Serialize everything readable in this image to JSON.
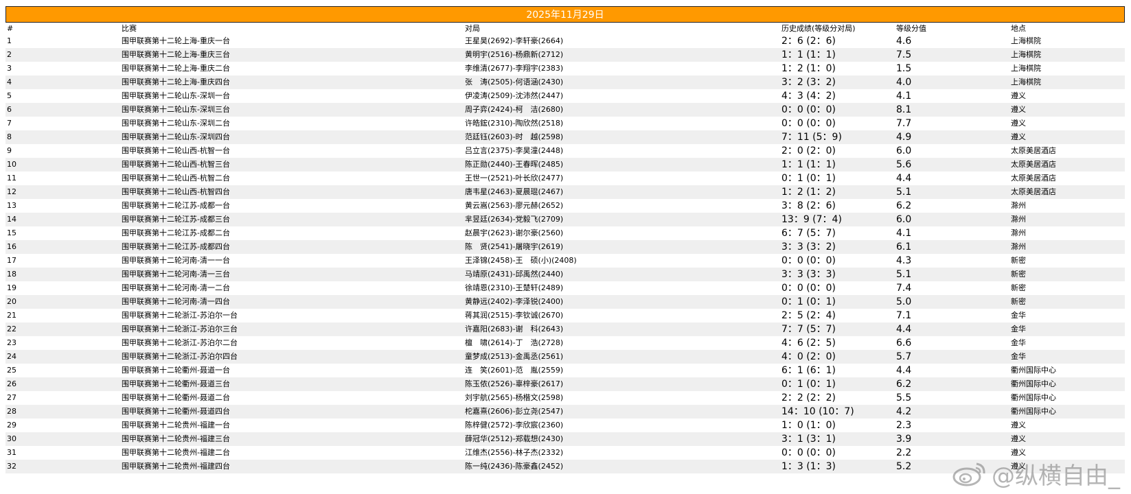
{
  "banner": {
    "date": "2025年11月29日"
  },
  "headers": {
    "num": "#",
    "match": "比赛",
    "game": "对局",
    "history": "历史成绩(等级分对局)",
    "diff": "等级分值",
    "location": "地点"
  },
  "rows": [
    {
      "num": "1",
      "match": "围甲联赛第十二轮上海-重庆一台",
      "game": "王星昊(2692)-李轩豪(2664)",
      "history": "2：6 (2：6)",
      "diff": "4.6",
      "location": "上海棋院"
    },
    {
      "num": "2",
      "match": "围甲联赛第十二轮上海-重庆三台",
      "game": "黄明宇(2516)-杨鼎新(2712)",
      "history": "1：1 (1：1)",
      "diff": "7.5",
      "location": "上海棋院"
    },
    {
      "num": "3",
      "match": "围甲联赛第十二轮上海-重庆二台",
      "game": "李维清(2677)-李翔宇(2383)",
      "history": "1：2 (1：0)",
      "diff": "1.5",
      "location": "上海棋院"
    },
    {
      "num": "4",
      "match": "围甲联赛第十二轮上海-重庆四台",
      "game": "张　涛(2505)-何语涵(2430)",
      "history": "3：2 (3：2)",
      "diff": "4.0",
      "location": "上海棋院"
    },
    {
      "num": "5",
      "match": "围甲联赛第十二轮山东-深圳一台",
      "game": "伊凌涛(2509)-沈沛然(2447)",
      "history": "4：3 (4：2)",
      "diff": "4.1",
      "location": "遵义"
    },
    {
      "num": "6",
      "match": "围甲联赛第十二轮山东-深圳三台",
      "game": "周子弈(2424)-柯　洁(2680)",
      "history": "0：0 (0：0)",
      "diff": "8.1",
      "location": "遵义"
    },
    {
      "num": "7",
      "match": "围甲联赛第十二轮山东-深圳二台",
      "game": "许皓鋐(2310)-陶欣然(2518)",
      "history": "0：0 (0：0)",
      "diff": "7.7",
      "location": "遵义"
    },
    {
      "num": "8",
      "match": "围甲联赛第十二轮山东-深圳四台",
      "game": "范廷钰(2603)-时　越(2598)",
      "history": "7：11 (5：9)",
      "diff": "4.9",
      "location": "遵义"
    },
    {
      "num": "9",
      "match": "围甲联赛第十二轮山西-杭智一台",
      "game": "吕立言(2375)-李昊潼(2448)",
      "history": "2：0 (2：0)",
      "diff": "6.0",
      "location": "太原美居酒店"
    },
    {
      "num": "10",
      "match": "围甲联赛第十二轮山西-杭智三台",
      "game": "陈正勋(2440)-王春晖(2485)",
      "history": "1：1 (1：1)",
      "diff": "5.6",
      "location": "太原美居酒店"
    },
    {
      "num": "11",
      "match": "围甲联赛第十二轮山西-杭智二台",
      "game": "王世一(2521)-叶长欣(2477)",
      "history": "0：1 (0：1)",
      "diff": "4.4",
      "location": "太原美居酒店"
    },
    {
      "num": "12",
      "match": "围甲联赛第十二轮山西-杭智四台",
      "game": "唐韦星(2463)-夏晨琨(2467)",
      "history": "1：2 (1：2)",
      "diff": "5.1",
      "location": "太原美居酒店"
    },
    {
      "num": "13",
      "match": "围甲联赛第十二轮江苏-成都一台",
      "game": "黄云嵩(2563)-廖元赫(2652)",
      "history": "3：8 (2：6)",
      "diff": "6.2",
      "location": "滁州"
    },
    {
      "num": "14",
      "match": "围甲联赛第十二轮江苏-成都三台",
      "game": "芈昱廷(2634)-党毅飞(2709)",
      "history": "13：9 (7：4)",
      "diff": "6.0",
      "location": "滁州"
    },
    {
      "num": "15",
      "match": "围甲联赛第十二轮江苏-成都二台",
      "game": "赵晨宇(2623)-谢尔豪(2560)",
      "history": "6：7 (5：7)",
      "diff": "4.1",
      "location": "滁州"
    },
    {
      "num": "16",
      "match": "围甲联赛第十二轮江苏-成都四台",
      "game": "陈　贤(2541)-屠晓宇(2619)",
      "history": "3：3 (3：2)",
      "diff": "6.1",
      "location": "滁州"
    },
    {
      "num": "17",
      "match": "围甲联赛第十二轮河南-清一一台",
      "game": "王泽锦(2458)-王　硕(小)(2408)",
      "history": "0：0 (0：0)",
      "diff": "4.3",
      "location": "新密"
    },
    {
      "num": "18",
      "match": "围甲联赛第十二轮河南-清一三台",
      "game": "马靖原(2431)-邱禹然(2440)",
      "history": "3：3 (3：3)",
      "diff": "5.1",
      "location": "新密"
    },
    {
      "num": "19",
      "match": "围甲联赛第十二轮河南-清一二台",
      "game": "徐靖恩(2310)-王楚轩(2489)",
      "history": "0：0 (0：0)",
      "diff": "7.4",
      "location": "新密"
    },
    {
      "num": "20",
      "match": "围甲联赛第十二轮河南-清一四台",
      "game": "黄静远(2402)-李泽锐(2400)",
      "history": "0：1 (0：1)",
      "diff": "5.0",
      "location": "新密"
    },
    {
      "num": "21",
      "match": "围甲联赛第十二轮浙江-苏泊尔一台",
      "game": "蒋其润(2515)-李钦诚(2670)",
      "history": "2：5 (2：4)",
      "diff": "7.1",
      "location": "金华"
    },
    {
      "num": "22",
      "match": "围甲联赛第十二轮浙江-苏泊尔三台",
      "game": "许嘉阳(2683)-谢　科(2643)",
      "history": "7：7 (5：7)",
      "diff": "4.4",
      "location": "金华"
    },
    {
      "num": "23",
      "match": "围甲联赛第十二轮浙江-苏泊尔二台",
      "game": "檀　啸(2614)-丁　浩(2728)",
      "history": "4：6 (2：5)",
      "diff": "6.6",
      "location": "金华"
    },
    {
      "num": "24",
      "match": "围甲联赛第十二轮浙江-苏泊尔四台",
      "game": "童梦成(2513)-金禹丞(2561)",
      "history": "4：0 (2：0)",
      "diff": "5.7",
      "location": "金华"
    },
    {
      "num": "25",
      "match": "围甲联赛第十二轮衢州-聂道一台",
      "game": "连　笑(2601)-范　胤(2559)",
      "history": "6：1 (6：1)",
      "diff": "4.4",
      "location": "衢州国际中心"
    },
    {
      "num": "26",
      "match": "围甲联赛第十二轮衢州-聂道三台",
      "game": "陈玉侬(2526)-辜梓豪(2617)",
      "history": "0：1 (0：1)",
      "diff": "6.2",
      "location": "衢州国际中心"
    },
    {
      "num": "27",
      "match": "围甲联赛第十二轮衢州-聂道二台",
      "game": "刘宇航(2565)-杨楷文(2598)",
      "history": "2：2 (2：2)",
      "diff": "5.5",
      "location": "衢州国际中心"
    },
    {
      "num": "28",
      "match": "围甲联赛第十二轮衢州-聂道四台",
      "game": "柁嘉熹(2606)-彭立尧(2547)",
      "history": "14：10 (10：7)",
      "diff": "4.2",
      "location": "衢州国际中心"
    },
    {
      "num": "29",
      "match": "围甲联赛第十二轮贵州-福建一台",
      "game": "陈梓健(2572)-李欣宸(2360)",
      "history": "1：0 (1：0)",
      "diff": "2.3",
      "location": "遵义"
    },
    {
      "num": "30",
      "match": "围甲联赛第十二轮贵州-福建三台",
      "game": "薛冠华(2512)-郑载想(2430)",
      "history": "3：1 (3：1)",
      "diff": "3.9",
      "location": "遵义"
    },
    {
      "num": "31",
      "match": "围甲联赛第十二轮贵州-福建二台",
      "game": "江维杰(2556)-林子杰(2332)",
      "history": "0：0 (0：0)",
      "diff": "2.2",
      "location": "遵义"
    },
    {
      "num": "32",
      "match": "围甲联赛第十二轮贵州-福建四台",
      "game": "陈一纯(2436)-陈豪鑫(2452)",
      "history": "1：3 (1：3)",
      "diff": "5.2",
      "location": "遵义"
    }
  ],
  "watermark": {
    "text": "@纵横自由_"
  },
  "colors": {
    "banner": "#ff9900",
    "stripe": "#efefef"
  }
}
